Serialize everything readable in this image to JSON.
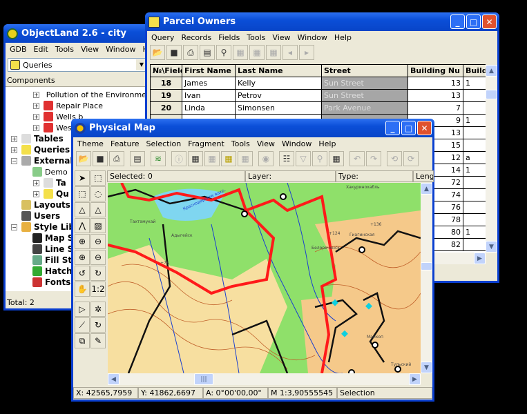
{
  "objectland": {
    "title": "ObjectLand 2.6  - city",
    "menu": [
      "GDB",
      "Edit",
      "Tools",
      "View",
      "Window",
      "He"
    ],
    "combo_value": "Queries",
    "components_label": "Components",
    "tree": [
      {
        "label": "Pollution of the Environment",
        "level": 2,
        "bold": false
      },
      {
        "label": "Repair Place",
        "level": 2,
        "bold": false
      },
      {
        "label": "Wells b",
        "level": 2,
        "bold": false
      },
      {
        "label": "West F",
        "level": 2,
        "bold": false
      },
      {
        "label": "Tables",
        "level": 0,
        "bold": true
      },
      {
        "label": "Queries",
        "level": 0,
        "bold": true
      },
      {
        "label": "External",
        "level": 0,
        "bold": true
      },
      {
        "label": "Demo",
        "level": 1,
        "bold": false
      },
      {
        "label": "Ta",
        "level": 2,
        "bold": true
      },
      {
        "label": "Qu",
        "level": 2,
        "bold": true
      },
      {
        "label": "Layouts",
        "level": 0,
        "bold": true
      },
      {
        "label": "Users",
        "level": 0,
        "bold": true
      },
      {
        "label": "Style Libr",
        "level": 0,
        "bold": true
      },
      {
        "label": "Map S",
        "level": 1,
        "bold": true
      },
      {
        "label": "Line S",
        "level": 1,
        "bold": true
      },
      {
        "label": "Fill St",
        "level": 1,
        "bold": true
      },
      {
        "label": "Hatch",
        "level": 1,
        "bold": true
      },
      {
        "label": "Fonts",
        "level": 1,
        "bold": true
      }
    ],
    "status": "Total: 2"
  },
  "parcel": {
    "title": "Parcel Owners",
    "menu": [
      "Query",
      "Records",
      "Fields",
      "Tools",
      "View",
      "Window",
      "Help"
    ],
    "columns": [
      "№\\Field",
      "First Name",
      "Last Name",
      "Street",
      "Building Nu",
      "Build"
    ],
    "rows": [
      {
        "n": "18",
        "first": "James",
        "last": "Kelly",
        "street": "Sun Street",
        "num": "13",
        "build": "1"
      },
      {
        "n": "19",
        "first": "Ivan",
        "last": "Petrov",
        "street": "Sun Street",
        "num": "13",
        "build": ""
      },
      {
        "n": "20",
        "first": "Linda",
        "last": "Simonsen",
        "street": "Park Avenue",
        "num": "7",
        "build": ""
      },
      {
        "num": "9",
        "build": "1"
      },
      {
        "num": "13",
        "build": ""
      },
      {
        "num": "15",
        "build": ""
      },
      {
        "num": "12",
        "build": "a"
      },
      {
        "num": "14",
        "build": "1"
      },
      {
        "num": "72",
        "build": ""
      },
      {
        "num": "74",
        "build": ""
      },
      {
        "num": "76",
        "build": ""
      },
      {
        "num": "78",
        "build": ""
      },
      {
        "num": "80",
        "build": "1"
      },
      {
        "num": "82",
        "build": ""
      }
    ]
  },
  "map": {
    "title": "Physical Map",
    "menu": [
      "Theme",
      "Feature",
      "Selection",
      "Fragment",
      "Tools",
      "View",
      "Window",
      "Help"
    ],
    "selected": "Selected: 0",
    "layer": "Layer:",
    "type": "Type:",
    "length": "Leng",
    "status": {
      "x": "X: 42565,7959",
      "y": "Y: 41862,6697",
      "a": "A:    0°00'00,00\"",
      "m": "M 1:3,90555545",
      "mode": "Selection"
    },
    "labels": [
      "Тахтамукай",
      "Адыгейск",
      "Краснодарское вдхр.",
      "Хакуринохабль",
      "Гиагинская",
      "Белореченск",
      "Майкоп",
      "Тульский",
      "+75",
      "+124",
      "+136"
    ]
  },
  "colors": {
    "titlebar": "#0b4fd8",
    "boundary": "#ff1a1a",
    "water": "#7fd6f0",
    "lowland": "#8fe06a",
    "upland": "#f5c98a"
  }
}
